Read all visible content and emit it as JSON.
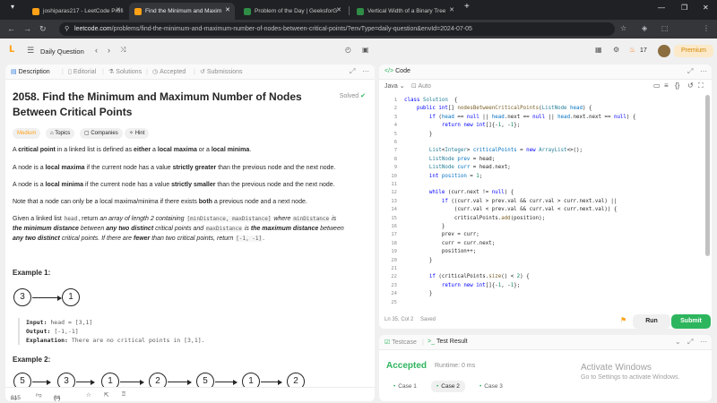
{
  "browser": {
    "tabs": [
      {
        "title": "joshiparas217 - LeetCode Profi",
        "favicon_color": "#ffa116",
        "active": false
      },
      {
        "title": "Find the Minimum and Maxim",
        "favicon_color": "#ffa116",
        "active": true
      },
      {
        "title": "Problem of the Day | GeeksforG",
        "favicon_color": "#2f8d46",
        "active": false
      },
      {
        "title": "Vertical Width of a Binary Tree",
        "favicon_color": "#2f8d46",
        "active": false
      }
    ],
    "new_tab": "+",
    "url_host": "leetcode.com",
    "url_path": "/problems/find-the-minimum-and-maximum-number-of-nodes-between-critical-points/?envType=daily-question&envId=2024-07-05"
  },
  "lc_header": {
    "daily_question": "Daily Question",
    "streak": "17",
    "premium": "Premium"
  },
  "description_tabs": [
    {
      "label": "Description",
      "icon": "doc-icon"
    },
    {
      "label": "Editorial",
      "icon": "book-icon"
    },
    {
      "label": "Solutions",
      "icon": "flask-icon"
    },
    {
      "label": "Accepted",
      "icon": "clock-icon"
    },
    {
      "label": "Submissions",
      "icon": "history-icon"
    }
  ],
  "problem": {
    "title": "2058. Find the Minimum and Maximum Number of Nodes Between Critical Points",
    "status": "Solved",
    "difficulty": "Medium",
    "chips": [
      "Topics",
      "Companies",
      "Hint"
    ],
    "p1": {
      "a": "A ",
      "b1": "critical point",
      "c": " in a linked list is defined as ",
      "b2": "either",
      "d": " a ",
      "b3": "local maxima",
      "e": " or a ",
      "b4": "local minima",
      "f": "."
    },
    "p2": {
      "a": "A node is a ",
      "b1": "local maxima",
      "c": " if the current node has a value ",
      "b2": "strictly greater",
      "d": " than the previous node and the next node."
    },
    "p3": {
      "a": "A node is a ",
      "b1": "local minima",
      "c": " if the current node has a value ",
      "b2": "strictly smaller",
      "d": " than the previous node and the next node."
    },
    "p4": {
      "a": "Note that a node can only be a local maxima/minima if there exists ",
      "b1": "both",
      "c": " a previous node and a next node."
    },
    "p5": {
      "a": "Given a linked list ",
      "code1": "head",
      "b": ", return ",
      "i1": "an array of length 2 containing ",
      "code2": "[minDistance, maxDistance]",
      "c": " where ",
      "code3": "minDistance",
      "d": " is",
      "bi1": "the minimum distance",
      "e": " between ",
      "bi2": "any two distinct",
      "f": " critical points and ",
      "code4": "maxDistance",
      "g": " is ",
      "bi3": "the maximum distance",
      "h": " between",
      "bi4": "any two distinct",
      "j": " critical points. If there are ",
      "bi5": "fewer",
      "k": " than two critical points, return ",
      "code5": "[-1, -1]",
      "l": "."
    },
    "example1": {
      "heading": "Example 1:",
      "nodes": [
        "3",
        "1"
      ],
      "input_label": "Input:",
      "input": " head = [3,1]",
      "output_label": "Output:",
      "output": " [-1,-1]",
      "explanation_label": "Explanation:",
      "explanation": " There are no critical points in [3,1]."
    },
    "example2": {
      "heading": "Example 2:",
      "nodes": [
        "5",
        "3",
        "1",
        "2",
        "5",
        "1",
        "2"
      ]
    }
  },
  "desc_footer": {
    "likes": "815",
    "comments": "64"
  },
  "code_panel": {
    "title": "Code",
    "language": "Java",
    "auto": "Auto",
    "status_pos": "Ln 35, Col 2",
    "status_saved": "Saved",
    "run": "Run",
    "submit": "Submit"
  },
  "code_lines": [
    {
      "n": "1",
      "parts": [
        [
          "kw",
          "class "
        ],
        [
          "ty",
          "Solution"
        ],
        [
          "",
          "  {"
        ]
      ]
    },
    {
      "n": "2",
      "parts": [
        [
          "",
          "    "
        ],
        [
          "kw",
          "public "
        ],
        [
          "kw",
          "int"
        ],
        [
          "",
          "[] "
        ],
        [
          "fn",
          "nodesBetweenCriticalPoints"
        ],
        [
          "",
          "("
        ],
        [
          "ty",
          "ListNode"
        ],
        [
          "nb",
          " head"
        ],
        [
          "",
          ") {"
        ]
      ]
    },
    {
      "n": "3",
      "parts": [
        [
          "",
          "        "
        ],
        [
          "kw",
          "if "
        ],
        [
          "",
          "("
        ],
        [
          "nb",
          "head"
        ],
        [
          "",
          " == "
        ],
        [
          "kw",
          "null"
        ],
        [
          "",
          " || "
        ],
        [
          "nb",
          "head"
        ],
        [
          "",
          ".next == "
        ],
        [
          "kw",
          "null"
        ],
        [
          "",
          " || "
        ],
        [
          "nb",
          "head"
        ],
        [
          "",
          ".next.next == "
        ],
        [
          "kw",
          "null"
        ],
        [
          "",
          ") {"
        ]
      ]
    },
    {
      "n": "4",
      "parts": [
        [
          "",
          "            "
        ],
        [
          "kw",
          "return new int"
        ],
        [
          "",
          "[]{-"
        ],
        [
          "nm",
          "1"
        ],
        [
          "",
          ", -"
        ],
        [
          "nm",
          "1"
        ],
        [
          "",
          "};"
        ]
      ]
    },
    {
      "n": "5",
      "parts": [
        [
          "",
          "        }"
        ]
      ]
    },
    {
      "n": "6",
      "parts": [
        [
          "",
          ""
        ]
      ]
    },
    {
      "n": "7",
      "parts": [
        [
          "",
          "        "
        ],
        [
          "ty",
          "List"
        ],
        [
          "",
          "<"
        ],
        [
          "ty",
          "Integer"
        ],
        [
          "",
          "> "
        ],
        [
          "nb",
          "criticalPoints"
        ],
        [
          "",
          " = "
        ],
        [
          "kw",
          "new "
        ],
        [
          "ty",
          "ArrayList"
        ],
        [
          "",
          "<>();"
        ]
      ]
    },
    {
      "n": "8",
      "parts": [
        [
          "",
          "        "
        ],
        [
          "ty",
          "ListNode "
        ],
        [
          "nb",
          "prev"
        ],
        [
          "",
          " = head;"
        ]
      ]
    },
    {
      "n": "9",
      "parts": [
        [
          "",
          "        "
        ],
        [
          "ty",
          "ListNode "
        ],
        [
          "nb",
          "curr"
        ],
        [
          "",
          " = head.next;"
        ]
      ]
    },
    {
      "n": "10",
      "parts": [
        [
          "",
          "        "
        ],
        [
          "kw",
          "int "
        ],
        [
          "nb",
          "position"
        ],
        [
          "",
          " = "
        ],
        [
          "nm",
          "1"
        ],
        [
          "",
          ";"
        ]
      ]
    },
    {
      "n": "11",
      "parts": [
        [
          "",
          ""
        ]
      ]
    },
    {
      "n": "12",
      "parts": [
        [
          "",
          "        "
        ],
        [
          "kw",
          "while "
        ],
        [
          "",
          "(curr.next != "
        ],
        [
          "kw",
          "null"
        ],
        [
          "",
          ") {"
        ]
      ]
    },
    {
      "n": "13",
      "parts": [
        [
          "",
          "            "
        ],
        [
          "kw",
          "if "
        ],
        [
          "",
          "((curr.val > prev.val && curr.val > curr.next.val) ||"
        ]
      ]
    },
    {
      "n": "14",
      "parts": [
        [
          "",
          "                (curr.val < prev.val && curr.val < curr.next.val)) {"
        ]
      ]
    },
    {
      "n": "15",
      "parts": [
        [
          "",
          "                criticalPoints."
        ],
        [
          "fn",
          "add"
        ],
        [
          "",
          "(position);"
        ]
      ]
    },
    {
      "n": "16",
      "parts": [
        [
          "",
          "            }"
        ]
      ]
    },
    {
      "n": "17",
      "parts": [
        [
          "",
          "            prev = curr;"
        ]
      ]
    },
    {
      "n": "18",
      "parts": [
        [
          "",
          "            curr = curr.next;"
        ]
      ]
    },
    {
      "n": "19",
      "parts": [
        [
          "",
          "            position++;"
        ]
      ]
    },
    {
      "n": "20",
      "parts": [
        [
          "",
          "        }"
        ]
      ]
    },
    {
      "n": "21",
      "parts": [
        [
          "",
          ""
        ]
      ]
    },
    {
      "n": "22",
      "parts": [
        [
          "",
          "        "
        ],
        [
          "kw",
          "if "
        ],
        [
          "",
          "(criticalPoints."
        ],
        [
          "fn",
          "size"
        ],
        [
          "",
          "() < "
        ],
        [
          "nm",
          "2"
        ],
        [
          "",
          ") {"
        ]
      ]
    },
    {
      "n": "23",
      "parts": [
        [
          "",
          "            "
        ],
        [
          "kw",
          "return new int"
        ],
        [
          "",
          "[]{-"
        ],
        [
          "nm",
          "1"
        ],
        [
          "",
          ", -"
        ],
        [
          "nm",
          "1"
        ],
        [
          "",
          "};"
        ]
      ]
    },
    {
      "n": "24",
      "parts": [
        [
          "",
          "        }"
        ]
      ]
    },
    {
      "n": "25",
      "parts": [
        [
          "",
          ""
        ]
      ]
    }
  ],
  "result_panel": {
    "tab_testcase": "Testcase",
    "tab_result": "Test Result",
    "verdict": "Accepted",
    "runtime": "Runtime: 0 ms",
    "cases": [
      "Case 1",
      "Case 2",
      "Case 3"
    ],
    "accent_color": "#2db55d"
  },
  "windows": {
    "line1": "Activate Windows",
    "line2": "Go to Settings to activate Windows."
  }
}
